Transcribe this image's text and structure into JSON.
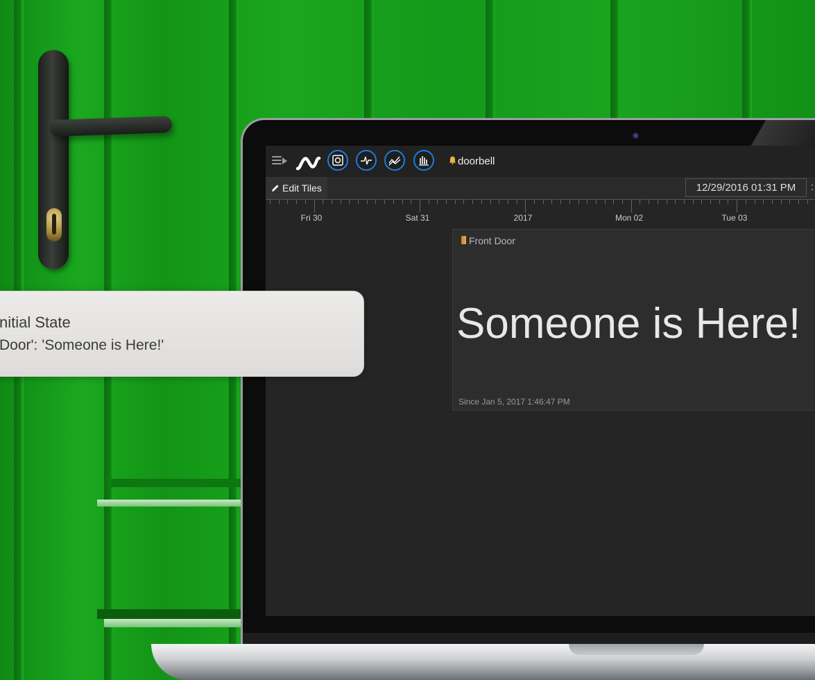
{
  "app": {
    "bucket_name": "doorbell",
    "edit_tiles_label": "Edit Tiles",
    "date_value": "12/29/2016 01:31 PM",
    "date_separator": ":"
  },
  "toolbar": {
    "icons": [
      "menu-icon",
      "initial-state-logo-icon",
      "tiles-view-icon",
      "waves-view-icon",
      "lines-view-icon",
      "bars-view-icon",
      "bell-icon"
    ]
  },
  "timeline": {
    "labels": [
      "Fri 30",
      "Sat 31",
      "2017",
      "Mon 02",
      "Tue 03"
    ]
  },
  "tile": {
    "title": "Front Door",
    "value": "Someone is Here!",
    "since": "Since Jan 5, 2017 1:46:47 PM"
  },
  "notification": {
    "title": "nitial State",
    "body": " Door': 'Someone is Here!'"
  },
  "colors": {
    "door_green": "#16a11b",
    "accent_blue": "#1a7fdc",
    "screen_bg": "#252525",
    "tile_bg": "#2d2d2d"
  }
}
